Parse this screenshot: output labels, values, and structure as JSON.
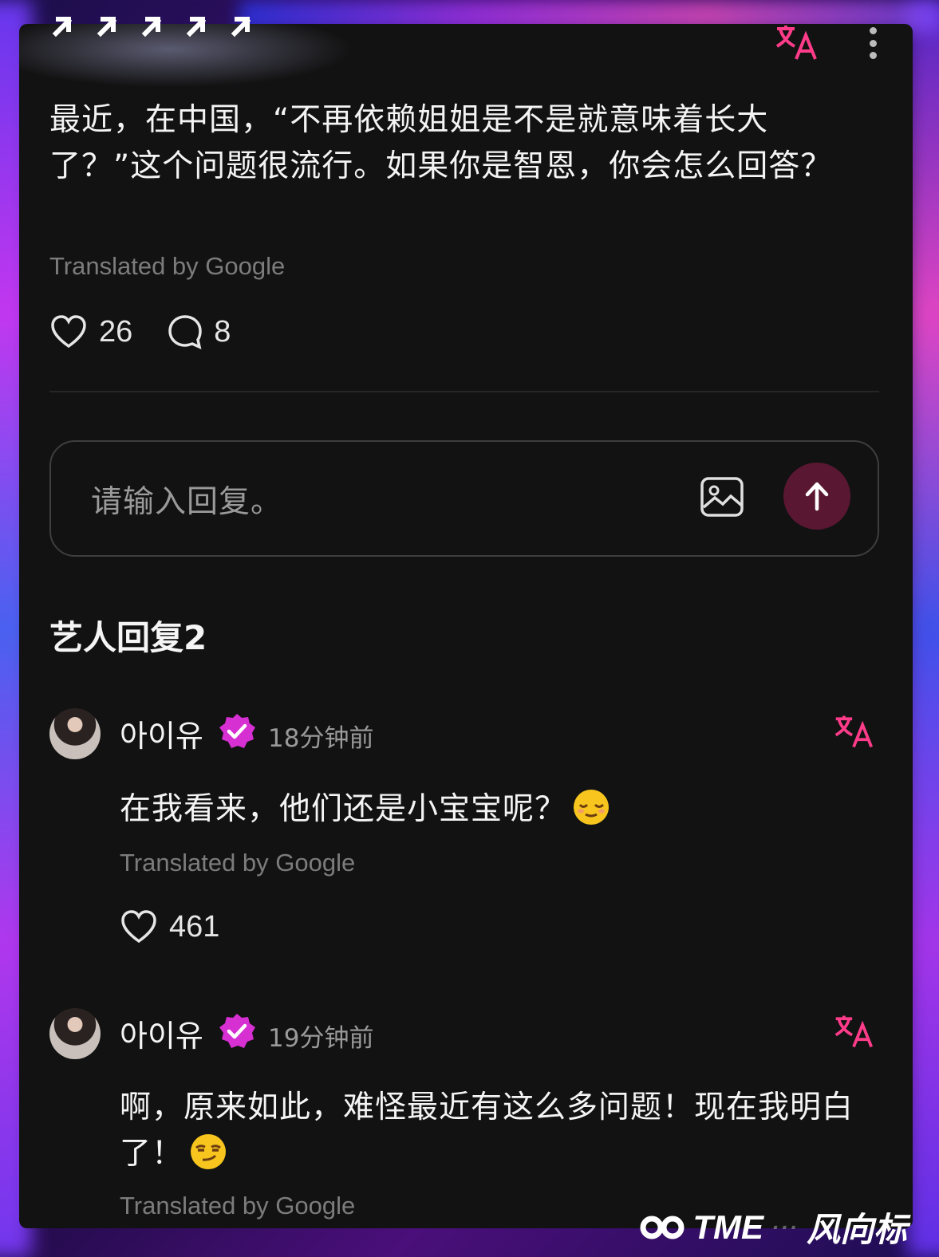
{
  "post": {
    "question": "最近，在中国，“不再依赖姐姐是不是就意味着长大了？”这个问题很流行。如果你是智恩，你会怎么回答？",
    "translated_by": "Translated by Google",
    "likes": "26",
    "comments": "8"
  },
  "reply_box": {
    "placeholder": "请输入回复。"
  },
  "artist_replies": {
    "title": "艺人回复2",
    "items": [
      {
        "username": "아이유",
        "time": "18分钟前",
        "text": "在我看来，他们还是小宝宝呢？",
        "emoji": "relieved-face-emoji",
        "translated_by": "Translated by Google",
        "likes": "461"
      },
      {
        "username": "아이유",
        "time": "19分钟前",
        "text": "啊，原来如此，难怪最近有这么多问题！现在我明白了！",
        "emoji": "smirking-face-emoji",
        "translated_by": "Translated by Google"
      }
    ]
  },
  "watermark": {
    "brand": "TME",
    "blurred": "···",
    "name": "风向标"
  },
  "colors": {
    "accent_pink": "#ff3c8a",
    "verified_purple": "#d62fd2",
    "send_button": "#5a1731",
    "panel_bg": "#121212"
  }
}
